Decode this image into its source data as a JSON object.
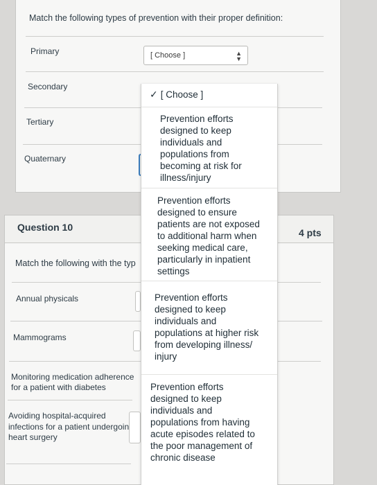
{
  "q9": {
    "prompt": "Match the following types of prevention with their proper definition:",
    "rows": [
      {
        "label": "Primary"
      },
      {
        "label": "Secondary"
      },
      {
        "label": "Tertiary"
      },
      {
        "label": "Quaternary"
      }
    ],
    "select_value": "[ Choose ]"
  },
  "q10": {
    "title": "Question 10",
    "points": "4 pts",
    "prompt": "Match the following with the typ",
    "rows": [
      {
        "label": "Annual physicals"
      },
      {
        "label": "Mammograms"
      },
      {
        "label": "Monitoring medication adherence\nfor a patient with diabetes"
      },
      {
        "label": "Avoiding hospital-acquired\ninfections for a patient undergoing\nheart surgery"
      }
    ]
  },
  "dropdown": {
    "options": [
      {
        "label": "[ Choose ]",
        "selected": true
      },
      {
        "label": "Prevention efforts\ndesigned to keep\nindividuals and\npopulations from\nbecoming at risk for\nillness/injury"
      },
      {
        "label": "Prevention efforts\ndesigned to ensure\npatients are not exposed\nto additional harm when\nseeking medical care,\nparticularly in inpatient\nsettings"
      },
      {
        "label": "Prevention efforts\ndesigned to keep\nindividuals and\npopulations at higher risk\nfrom developing illness/\ninjury"
      },
      {
        "label": "Prevention efforts\ndesigned to keep\nindividuals and\npopulations from having\nacute episodes related to\nthe poor management of\nchronic disease"
      }
    ]
  }
}
